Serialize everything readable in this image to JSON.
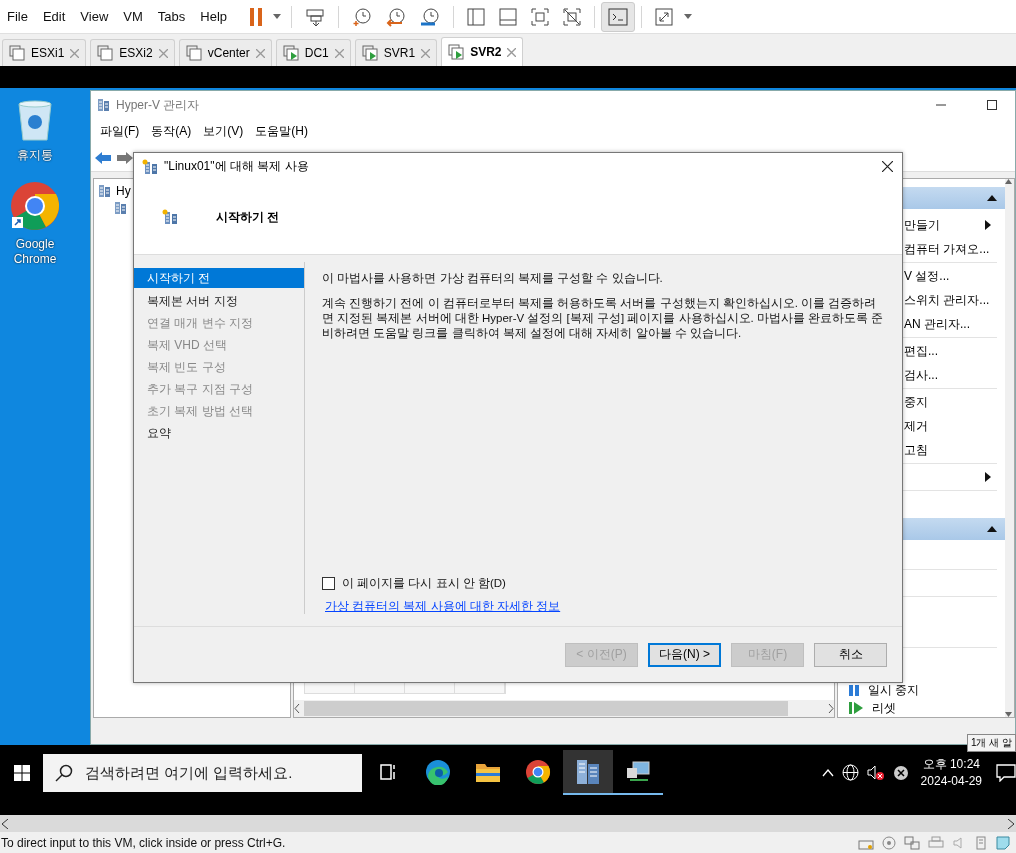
{
  "app_menu": [
    "File",
    "Edit",
    "View",
    "VM",
    "Tabs",
    "Help"
  ],
  "toolbar": [
    {
      "kind": "pause",
      "pressed": false,
      "dropdown": true
    },
    {
      "kind": "separator"
    },
    {
      "kind": "send-keys",
      "pressed": false
    },
    {
      "kind": "separator"
    },
    {
      "kind": "snapshot",
      "pressed": false
    },
    {
      "kind": "revert",
      "pressed": false
    },
    {
      "kind": "manager",
      "pressed": false
    },
    {
      "kind": "separator"
    },
    {
      "kind": "library",
      "pressed": false
    },
    {
      "kind": "thumbnails",
      "pressed": false
    },
    {
      "kind": "fit",
      "pressed": false
    },
    {
      "kind": "unfit",
      "pressed": false
    },
    {
      "kind": "separator"
    },
    {
      "kind": "console",
      "pressed": true
    },
    {
      "kind": "separator"
    },
    {
      "kind": "fullscreen",
      "pressed": false,
      "dropdown": true
    }
  ],
  "vm_tabs": [
    {
      "label": "ESXi1",
      "running": false,
      "selected": false
    },
    {
      "label": "ESXi2",
      "running": false,
      "selected": false
    },
    {
      "label": "vCenter",
      "running": false,
      "selected": false
    },
    {
      "label": "DC1",
      "running": true,
      "selected": false
    },
    {
      "label": "SVR1",
      "running": true,
      "selected": false
    },
    {
      "label": "SVR2",
      "running": true,
      "selected": true
    }
  ],
  "desktop_icons": [
    {
      "kind": "recycle-bin",
      "label": "휴지통"
    },
    {
      "kind": "chrome",
      "label": "Google Chrome"
    }
  ],
  "hyperv_window": {
    "title": "Hyper-V 관리자",
    "menu": [
      "파일(F)",
      "동작(A)",
      "보기(V)",
      "도움말(H)"
    ],
    "tree_root": "Hy",
    "actions": [
      {
        "kind": "header"
      },
      {
        "kind": "submenu",
        "text": "만들기"
      },
      {
        "kind": "item",
        "text": "컴퓨터 가져오..."
      },
      {
        "kind": "separator"
      },
      {
        "kind": "item",
        "text": "V 설정..."
      },
      {
        "kind": "item",
        "text": "스위치 관리자..."
      },
      {
        "kind": "item",
        "text": "AN 관리자..."
      },
      {
        "kind": "separator"
      },
      {
        "kind": "item",
        "text": "편집..."
      },
      {
        "kind": "item",
        "text": "검사..."
      },
      {
        "kind": "separator"
      },
      {
        "kind": "item",
        "text": "중지"
      },
      {
        "kind": "item",
        "text": "제거"
      },
      {
        "kind": "item",
        "text": "고침"
      },
      {
        "kind": "separator"
      },
      {
        "kind": "submenu"
      },
      {
        "kind": "separator"
      },
      {
        "kind": "blank"
      },
      {
        "kind": "header"
      },
      {
        "kind": "blank"
      },
      {
        "kind": "separator"
      },
      {
        "kind": "blank"
      },
      {
        "kind": "separator"
      },
      {
        "kind": "blank"
      },
      {
        "kind": "blank"
      },
      {
        "kind": "separator"
      },
      {
        "kind": "pause",
        "text": "일시 중지"
      },
      {
        "kind": "reset",
        "text": "리셋"
      }
    ]
  },
  "dialog": {
    "title": "\"Linux01\"에 대해 복제 사용",
    "heading": "시작하기 전",
    "steps": [
      {
        "label": "시작하기 전",
        "selected": true,
        "disabled": false
      },
      {
        "label": "복제본 서버 지정",
        "selected": false,
        "disabled": false
      },
      {
        "label": "연결 매개 변수 지정",
        "selected": false,
        "disabled": true
      },
      {
        "label": "복제 VHD 선택",
        "selected": false,
        "disabled": true
      },
      {
        "label": "복제 빈도 구성",
        "selected": false,
        "disabled": true
      },
      {
        "label": "추가 복구 지점 구성",
        "selected": false,
        "disabled": true
      },
      {
        "label": "초기 복제 방법 선택",
        "selected": false,
        "disabled": true
      },
      {
        "label": "요약",
        "selected": false,
        "disabled": false
      }
    ],
    "paragraphs": [
      "이 마법사를 사용하면 가상 컴퓨터의 복제를 구성할 수 있습니다.",
      "계속 진행하기 전에 이 컴퓨터로부터 복제를 허용하도록 서버를 구성했는지 확인하십시오. 이를 검증하려면 지정된 복제본 서버에 대한 Hyper-V 설정의 [복제 구성] 페이지를 사용하십시오. 마법사를 완료하도록 준비하려면 도움말 링크를 클릭하여 복제 설정에 대해 자세히 알아볼 수 있습니다."
    ],
    "checkbox": {
      "label": "이 페이지를 다시 표시 안 함(D)",
      "checked": false
    },
    "link": "가상 컴퓨터의 복제 사용에 대한 자세한 정보",
    "buttons": [
      {
        "label": "< 이전(P)",
        "disabled": true,
        "default": false
      },
      {
        "label": "다음(N) >",
        "disabled": false,
        "default": true
      },
      {
        "label": "마침(F)",
        "disabled": true,
        "default": false
      },
      {
        "label": "취소",
        "disabled": false,
        "default": false
      }
    ]
  },
  "taskbar": {
    "search": {
      "placeholder": "검색하려면 여기에 입력하세요."
    },
    "apps": [
      {
        "kind": "task-view",
        "active": false,
        "open": false
      },
      {
        "kind": "edge",
        "active": false,
        "open": false
      },
      {
        "kind": "explorer",
        "active": false,
        "open": false
      },
      {
        "kind": "chrome",
        "active": false,
        "open": false
      },
      {
        "kind": "hyperv",
        "active": true,
        "open": true
      },
      {
        "kind": "network",
        "active": false,
        "open": true
      }
    ],
    "time": "오후 10:24",
    "date": "2024-04-29",
    "tooltip": "1개 새 알"
  },
  "status_bar": {
    "text": "To direct input to this VM, click inside or press Ctrl+G."
  }
}
